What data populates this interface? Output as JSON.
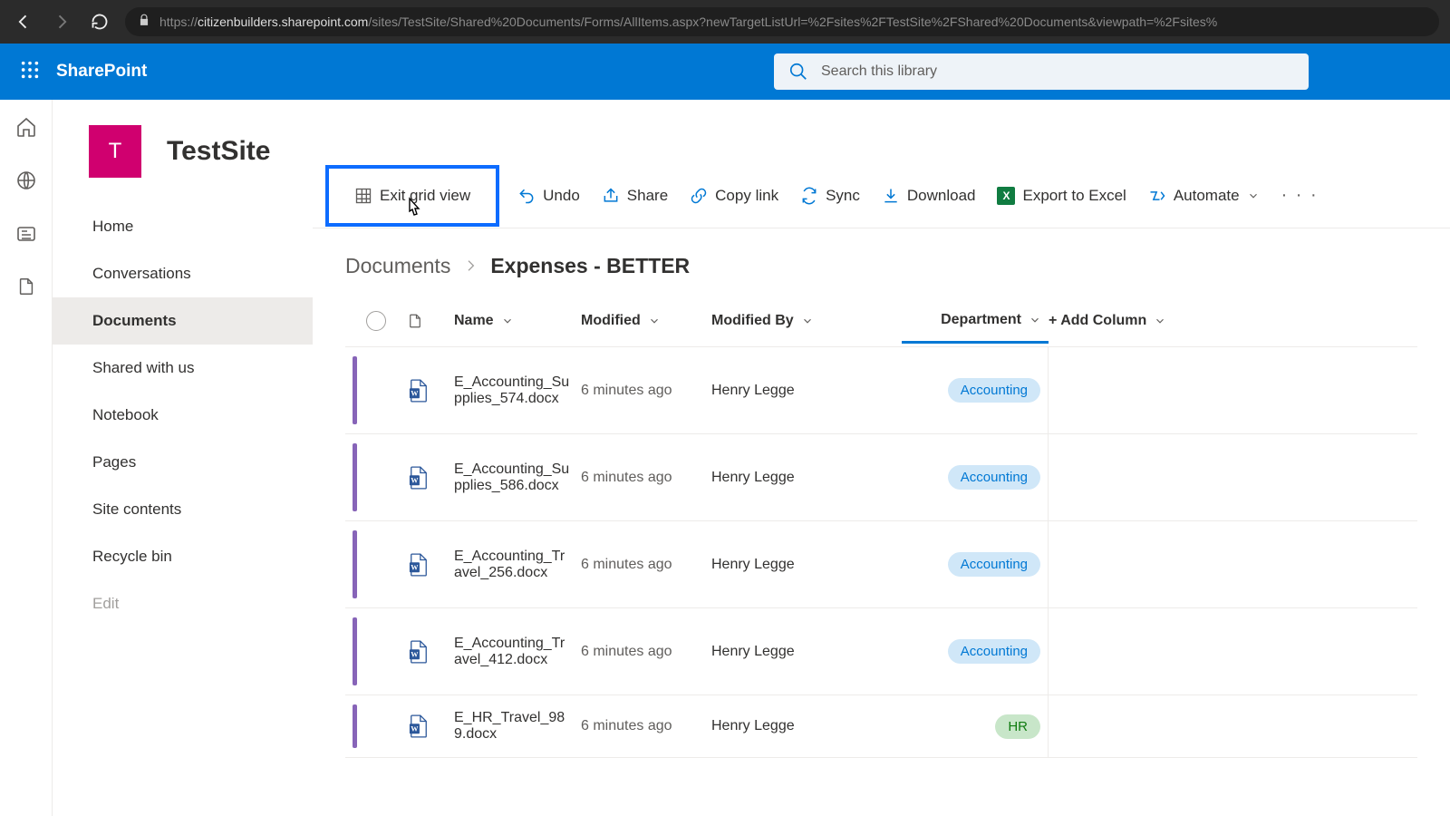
{
  "browser": {
    "url_scheme": "https://",
    "url_host": "citizenbuilders.sharepoint.com",
    "url_path": "/sites/TestSite/Shared%20Documents/Forms/AllItems.aspx?newTargetListUrl=%2Fsites%2FTestSite%2FShared%20Documents&viewpath=%2Fsites%"
  },
  "suite": {
    "brand": "SharePoint",
    "search_placeholder": "Search this library"
  },
  "site": {
    "logo_letter": "T",
    "title": "TestSite"
  },
  "nav": {
    "items": [
      {
        "label": "Home"
      },
      {
        "label": "Conversations"
      },
      {
        "label": "Documents"
      },
      {
        "label": "Shared with us"
      },
      {
        "label": "Notebook"
      },
      {
        "label": "Pages"
      },
      {
        "label": "Site contents"
      },
      {
        "label": "Recycle bin"
      }
    ],
    "edit": "Edit"
  },
  "commands": {
    "exit_grid": "Exit grid view",
    "undo": "Undo",
    "share": "Share",
    "copy_link": "Copy link",
    "sync": "Sync",
    "download": "Download",
    "export": "Export to Excel",
    "automate": "Automate"
  },
  "breadcrumb": {
    "root": "Documents",
    "current": "Expenses - BETTER"
  },
  "columns": {
    "name": "Name",
    "modified": "Modified",
    "modified_by": "Modified By",
    "department": "Department",
    "add": "+ Add Column"
  },
  "rows": [
    {
      "name": "E_Accounting_Supplies_574.docx",
      "modified": "6 minutes ago",
      "by": "Henry Legge",
      "dept": "Accounting",
      "pill": "acc"
    },
    {
      "name": "E_Accounting_Supplies_586.docx",
      "modified": "6 minutes ago",
      "by": "Henry Legge",
      "dept": "Accounting",
      "pill": "acc"
    },
    {
      "name": "E_Accounting_Travel_256.docx",
      "modified": "6 minutes ago",
      "by": "Henry Legge",
      "dept": "Accounting",
      "pill": "acc"
    },
    {
      "name": "E_Accounting_Travel_412.docx",
      "modified": "6 minutes ago",
      "by": "Henry Legge",
      "dept": "Accounting",
      "pill": "acc"
    },
    {
      "name": "E_HR_Travel_989.docx",
      "modified": "6 minutes ago",
      "by": "Henry Legge",
      "dept": "HR",
      "pill": "hr"
    }
  ]
}
